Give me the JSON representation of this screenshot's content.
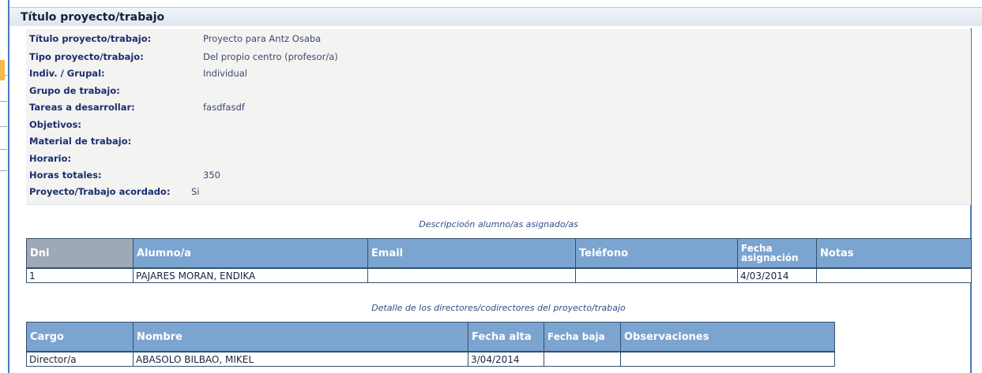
{
  "window": {
    "title": "Título proyecto/trabajo"
  },
  "details": [
    {
      "label": "Título proyecto/trabajo:",
      "value": "Proyecto para Antz Osaba"
    },
    {
      "label": "Tipo proyecto/trabajo:",
      "value": "Del propio centro (profesor/a)"
    },
    {
      "label": "Indiv. / Grupal:",
      "value": "Individual"
    },
    {
      "label": "Grupo de trabajo:",
      "value": ""
    },
    {
      "label": "Tareas a desarrollar:",
      "value": "fasdfasdf"
    },
    {
      "label": "Objetivos:",
      "value": ""
    },
    {
      "label": "Material de trabajo:",
      "value": ""
    },
    {
      "label": "Horario:",
      "value": ""
    },
    {
      "label": "Horas totales:",
      "value": "350"
    },
    {
      "label": "Proyecto/Trabajo acordado:",
      "value": "Si"
    }
  ],
  "students": {
    "caption": "Descripcioón alumno/as asignado/as",
    "headers": [
      "Dni",
      "Alumno/a",
      "Email",
      "Teléfono",
      "Fecha asignación",
      "Notas"
    ],
    "rows": [
      {
        "dni": "1",
        "alumno": "PAJARES MORAN, ENDIKA",
        "email": "",
        "telefono": "",
        "fecha": "4/03/2014",
        "notas": ""
      }
    ]
  },
  "directors": {
    "caption": "Detalle de los directores/codirectores del proyecto/trabajo",
    "headers": [
      "Cargo",
      "Nombre",
      "Fecha alta",
      "Fecha baja",
      "Observaciones"
    ],
    "rows": [
      {
        "cargo": "Director/a",
        "nombre": "ABASOLO BILBAO, MIKEL",
        "alta": "3/04/2014",
        "baja": "",
        "obs": ""
      }
    ]
  },
  "colors": {
    "header": "#7ba4d0",
    "header_dark": "#9fa8b8",
    "panel": "#f3f3f2",
    "frame": "#4a78c4"
  }
}
